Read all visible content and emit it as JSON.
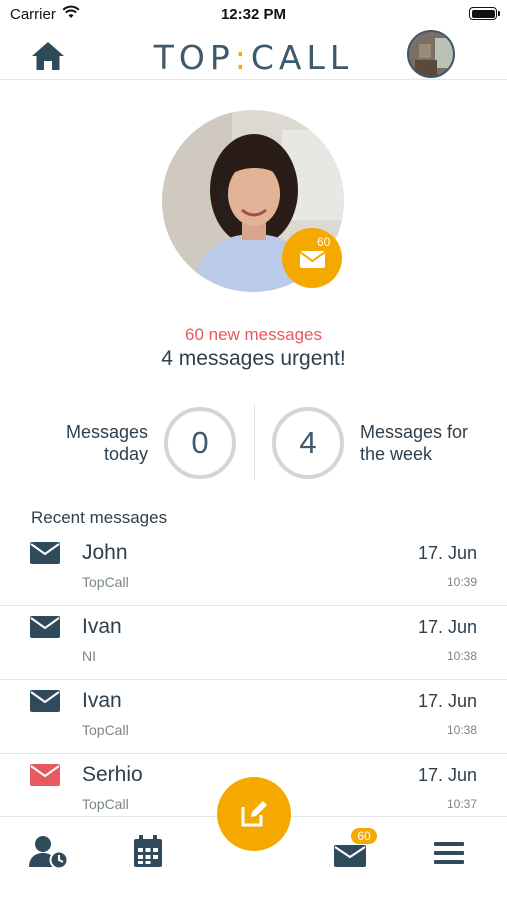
{
  "status_bar": {
    "carrier": "Carrier",
    "time": "12:32 PM"
  },
  "header": {
    "logo_text_left": "TOP",
    "logo_colon": ":",
    "logo_text_right": "CALL"
  },
  "profile": {
    "mail_badge_count": "60"
  },
  "summary": {
    "new_messages": "60 new messages",
    "urgent": "4 messages urgent!"
  },
  "stats": {
    "today_label_line1": "Messages",
    "today_label_line2": "today",
    "today_value": "0",
    "week_value": "4",
    "week_label_line1": "Messages for",
    "week_label_line2": "the week"
  },
  "recent": {
    "title": "Recent messages",
    "messages": [
      {
        "sender": "John",
        "subject": "TopCall",
        "date": "17. Jun",
        "time": "10:39",
        "urgent": false
      },
      {
        "sender": "Ivan",
        "subject": "NI",
        "date": "17. Jun",
        "time": "10:38",
        "urgent": false
      },
      {
        "sender": "Ivan",
        "subject": "TopCall",
        "date": "17. Jun",
        "time": "10:38",
        "urgent": false
      },
      {
        "sender": "Serhio",
        "subject": "TopCall",
        "date": "17. Jun",
        "time": "10:37",
        "urgent": true
      }
    ]
  },
  "tab_bar": {
    "inbox_badge": "60"
  },
  "colors": {
    "accent": "#f5a800",
    "primary": "#3c5a6d",
    "urgent": "#e8595f",
    "muted": "#7b858c"
  },
  "icons": [
    "wifi-icon",
    "battery-icon",
    "home-icon",
    "mail-icon",
    "contacts-clock-icon",
    "calendar-icon",
    "compose-icon",
    "inbox-icon",
    "menu-icon"
  ]
}
